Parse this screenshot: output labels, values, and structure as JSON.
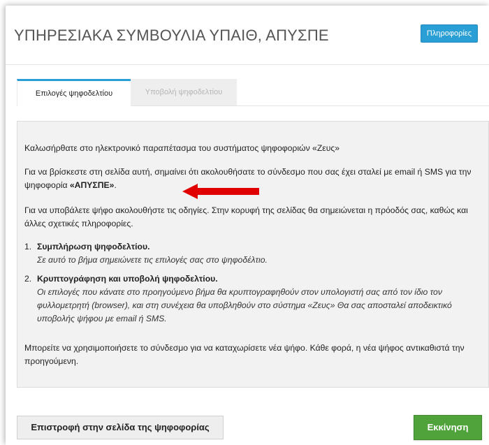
{
  "header": {
    "title": "ΥΠΗΡΕΣΙΑΚΑ ΣΥΜΒΟΥΛΙΑ ΥΠΑΙΘ, ΑΠΥΣΠΕ",
    "info_button": "Πληροφορίες"
  },
  "tabs": [
    {
      "label": "Επιλογές ψηφοδελτίου",
      "state": "active"
    },
    {
      "label": "Υποβολή ψηφοδελτίου",
      "state": "disabled"
    }
  ],
  "content": {
    "welcome": "Καλωσήρθατε στο ηλεκτρονικό παραπέτασμα του συστήματος ψηφοφοριών «Ζευς»",
    "link_note_before": "Για να βρίσκεστε στη σελίδα αυτή, σημαίνει ότι ακολουθήσατε το σύνδεσμο που σας έχει σταλεί με email ή SMS για την ψηφοφορία ",
    "election_name": "«ΑΠΥΣΠΕ»",
    "link_note_after": ".",
    "instructions": "Για να υποβάλετε ψήφο ακολουθήστε τις οδηγίες. Στην κορυφή της σελίδας θα σημειώνεται η πρόοδός σας, καθώς και άλλες σχετικές πληροφορίες.",
    "steps": [
      {
        "number": "1.",
        "title": "Συμπλήρωση ψηφοδελτίου.",
        "description": "Σε αυτό το βήμα σημειώνετε τις επιλογές σας στο ψηφοδέλτιο."
      },
      {
        "number": "2.",
        "title": "Κρυπτογράφηση και υποβολή ψηφοδελτίου.",
        "description": "Οι επιλογές που κάνατε στο προηγούμενο βήμα θα κρυπτογραφηθούν στον υπολογιστή σας από τον ίδιο τον φυλλομετρητή (browser), και στη συνέχεια θα υποβληθούν στο σύστημα «Ζευς» Θα σας αποσταλεί αποδεικτικό υποβολής ψήφου με email ή SMS."
      }
    ],
    "revote_note": "Μπορείτε να χρησιμοποιήσετε το σύνδεσμο για να καταχωρίσετε νέα ψήφο. Κάθε φορά, η νέα ψήφος αντικαθιστά την προηγούμενη."
  },
  "buttons": {
    "back": "Επιστροφή στην σελίδα της ψηφοφορίας",
    "start": "Εκκίνηση"
  },
  "colors": {
    "accent": "#2a9fd6",
    "start_button": "#4fa33a",
    "annotation_arrow": "#e00000",
    "panel_bg": "#f2f2f2"
  },
  "icons": {
    "annotation": "red-arrow-icon"
  }
}
